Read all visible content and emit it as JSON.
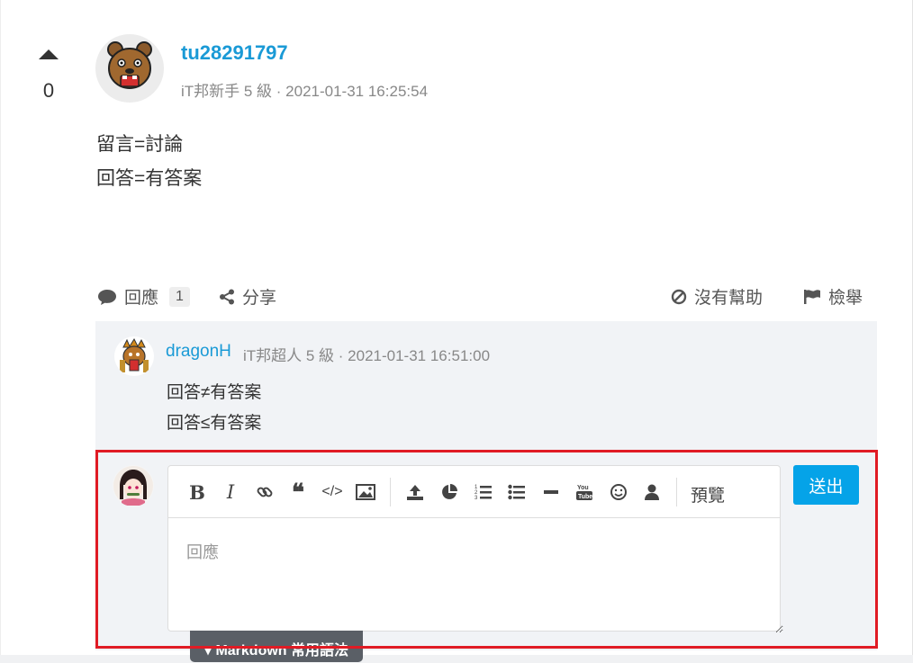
{
  "post": {
    "vote_count": "0",
    "author": {
      "name": "tu28291797",
      "meta": "iT邦新手 5 級 · 2021-01-31 16:25:54"
    },
    "body_lines": [
      "留言=討論",
      "回答=有答案"
    ]
  },
  "actions": {
    "reply_label": "回應",
    "reply_count": "1",
    "share_label": "分享",
    "not_helpful_label": "沒有幫助",
    "report_label": "檢舉"
  },
  "comment": {
    "author": "dragonH",
    "meta": "iT邦超人 5 級 · 2021-01-31 16:51:00",
    "lines": [
      "回答≠有答案",
      "回答≤有答案"
    ]
  },
  "editor": {
    "toolbar_icons": [
      "bold-icon",
      "italic-icon",
      "link-icon",
      "quote-icon",
      "code-icon",
      "image-icon",
      "upload-icon",
      "chart-icon",
      "ordered-list-icon",
      "unordered-list-icon",
      "horizontal-rule-icon",
      "youtube-icon",
      "emoji-icon",
      "user-icon"
    ],
    "preview_label": "預覽",
    "placeholder": "回應",
    "submit_label": "送出",
    "markdown_tab_label": "▾ Markdown 常用語法"
  },
  "colors": {
    "link": "#1a9ad6",
    "submit": "#05a3e8",
    "highlight": "#e01b24",
    "comment_bg": "#f1f3f6"
  }
}
